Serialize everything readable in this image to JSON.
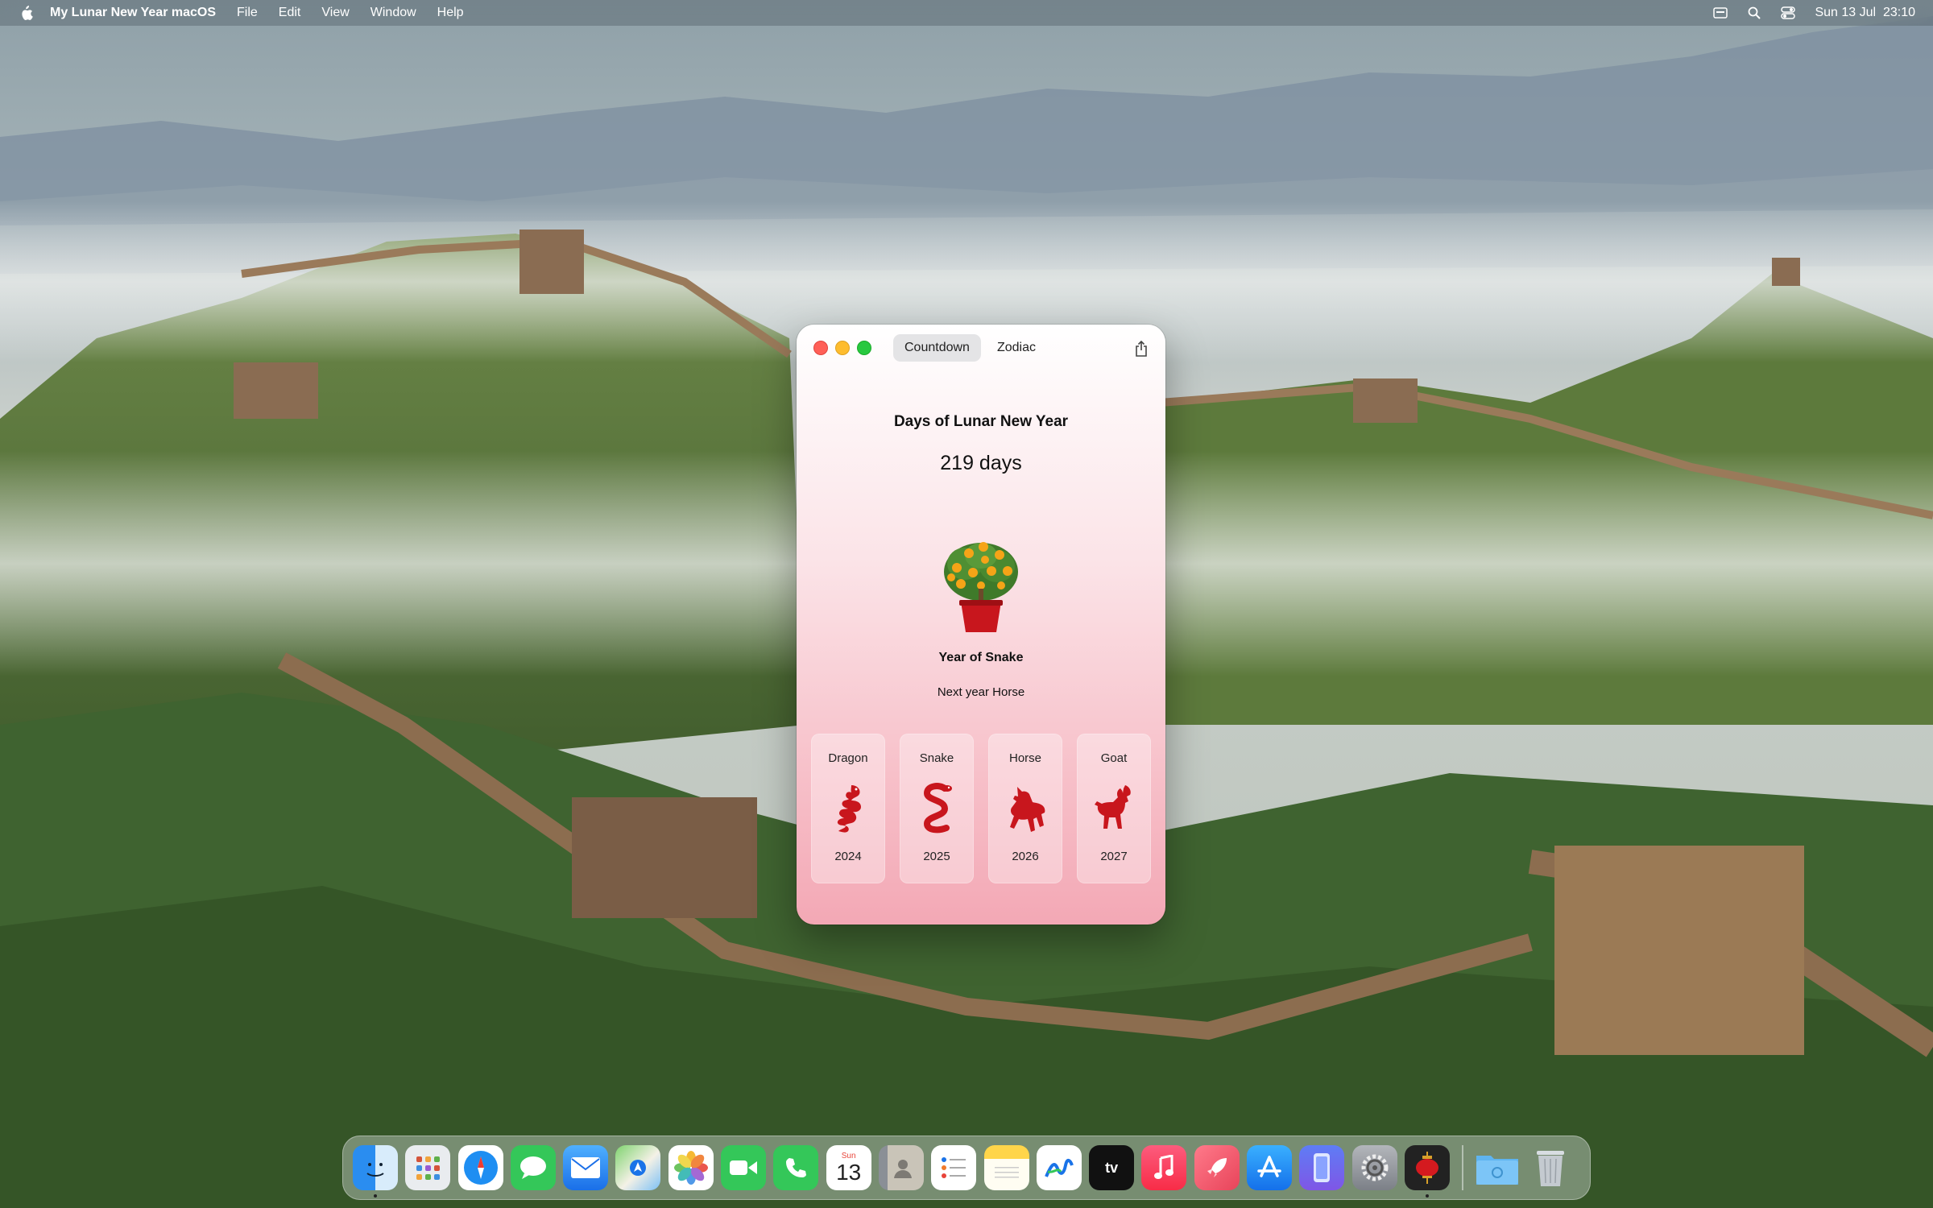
{
  "menubar": {
    "app_name": "My Lunar New Year macOS",
    "menus": [
      "File",
      "Edit",
      "View",
      "Window",
      "Help"
    ],
    "clock": "Sun 13 Jul  23:10"
  },
  "window": {
    "tabs": [
      "Countdown",
      "Zodiac"
    ],
    "active_tab": "Countdown",
    "title": "Days of Lunar New Year",
    "days_left": "219 days",
    "current_year": "Year of Snake",
    "next_year": "Next year Horse",
    "zodiac_cards": [
      {
        "name": "Dragon",
        "year": "2024",
        "icon": "dragon-icon"
      },
      {
        "name": "Snake",
        "year": "2025",
        "icon": "snake-icon"
      },
      {
        "name": "Horse",
        "year": "2026",
        "icon": "horse-icon"
      },
      {
        "name": "Goat",
        "year": "2027",
        "icon": "goat-icon"
      }
    ],
    "accent_color": "#c8161d"
  },
  "dock": {
    "calendar_month": "Sun",
    "calendar_day": "13",
    "apps": [
      "finder",
      "launchpad",
      "safari",
      "messages",
      "mail",
      "maps",
      "photos",
      "facetime",
      "phone",
      "calendar",
      "contacts",
      "reminders",
      "notes",
      "freeform",
      "tv",
      "music",
      "rocket",
      "app-store",
      "iphone-mirroring",
      "system-settings",
      "lunar-new-year",
      "downloads",
      "trash"
    ],
    "running": [
      "finder",
      "lunar-new-year"
    ]
  }
}
